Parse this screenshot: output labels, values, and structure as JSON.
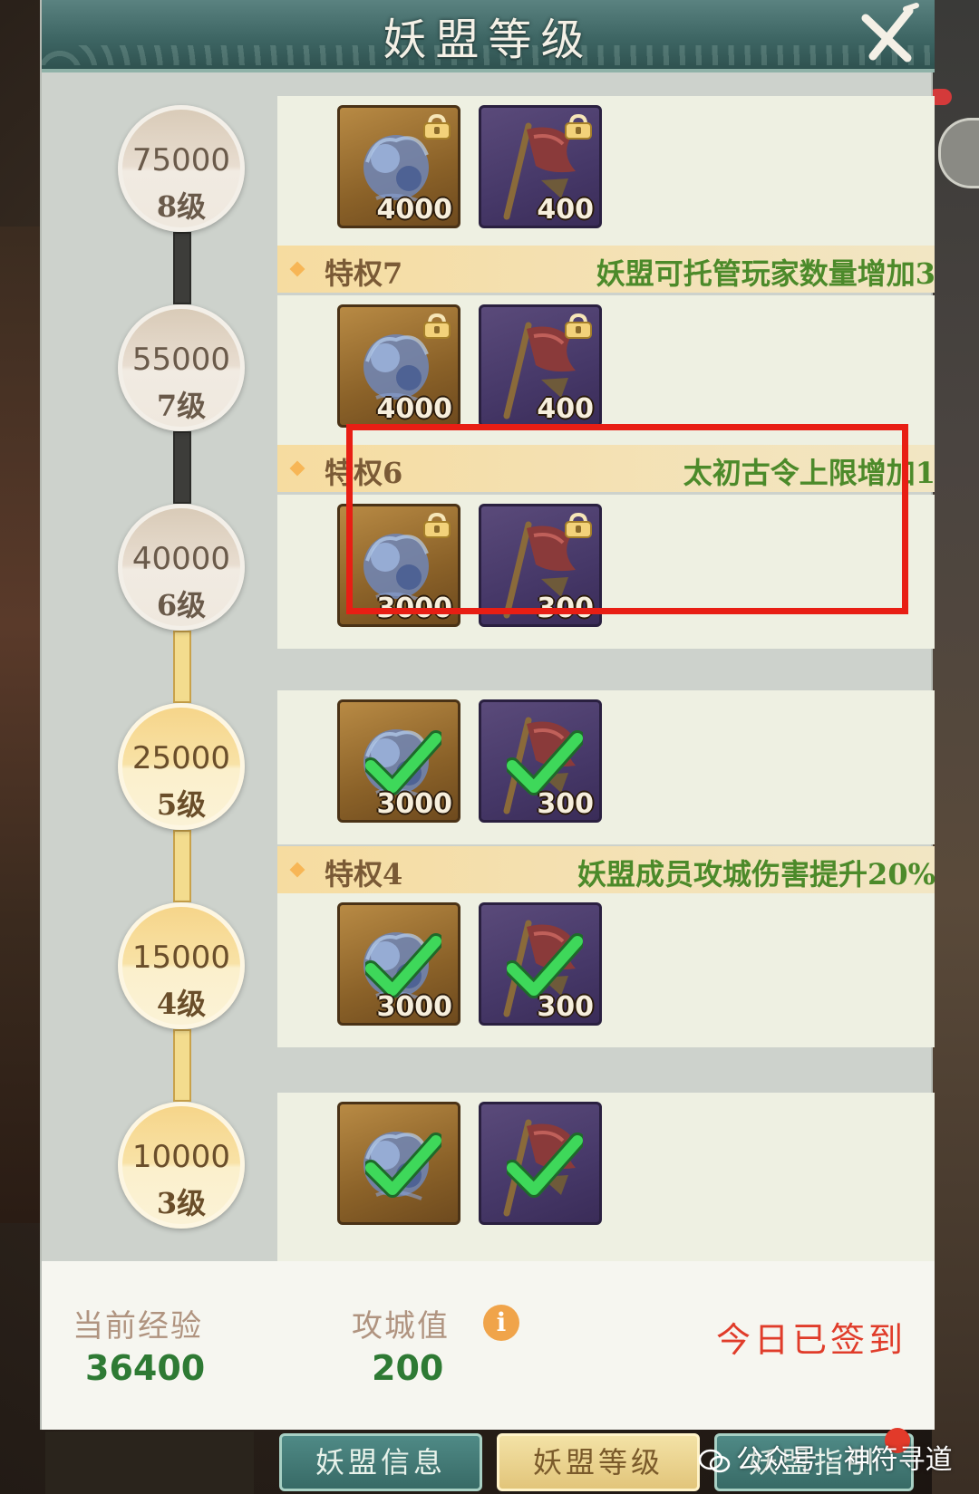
{
  "header": {
    "title": "妖盟等级"
  },
  "levels": [
    {
      "exp": "75000",
      "level": "8级",
      "state": "locked",
      "rewards": [
        {
          "icon": "spirit-orb-icon",
          "qty": "4000",
          "claimed": false,
          "locked": true
        },
        {
          "icon": "war-flag-icon",
          "qty": "400",
          "claimed": false,
          "locked": true
        }
      ]
    },
    {
      "exp": "55000",
      "level": "7级",
      "state": "locked",
      "privilege": {
        "name": "特权7",
        "desc": "妖盟可托管玩家数量增加3"
      },
      "rewards": [
        {
          "icon": "spirit-orb-icon",
          "qty": "4000",
          "claimed": false,
          "locked": true
        },
        {
          "icon": "war-flag-icon",
          "qty": "400",
          "claimed": false,
          "locked": true
        }
      ]
    },
    {
      "exp": "40000",
      "level": "6级",
      "state": "locked",
      "privilege": {
        "name": "特权6",
        "desc": "太初古令上限增加1"
      },
      "rewards": [
        {
          "icon": "spirit-orb-icon",
          "qty": "3000",
          "claimed": false,
          "locked": true
        },
        {
          "icon": "war-flag-icon",
          "qty": "300",
          "claimed": false,
          "locked": true
        }
      ]
    },
    {
      "exp": "25000",
      "level": "5级",
      "state": "unlocked",
      "rewards": [
        {
          "icon": "spirit-orb-icon",
          "qty": "3000",
          "claimed": true,
          "locked": false
        },
        {
          "icon": "war-flag-icon",
          "qty": "300",
          "claimed": true,
          "locked": false
        }
      ]
    },
    {
      "exp": "15000",
      "level": "4级",
      "state": "unlocked",
      "privilege": {
        "name": "特权4",
        "desc": "妖盟成员攻城伤害提升20%"
      },
      "rewards": [
        {
          "icon": "spirit-orb-icon",
          "qty": "3000",
          "claimed": true,
          "locked": false
        },
        {
          "icon": "war-flag-icon",
          "qty": "300",
          "claimed": true,
          "locked": false
        }
      ]
    },
    {
      "exp": "10000",
      "level": "3级",
      "state": "unlocked",
      "rewards": [
        {
          "icon": "spirit-orb-icon",
          "qty": "",
          "claimed": true,
          "locked": false
        },
        {
          "icon": "war-flag-icon",
          "qty": "",
          "claimed": true,
          "locked": false
        }
      ]
    }
  ],
  "footer": {
    "exp_label": "当前经验",
    "exp_value": "36400",
    "siege_label": "攻城值",
    "siege_value": "200",
    "info_glyph": "i",
    "signed_text": "今日已签到"
  },
  "tabs": [
    {
      "label": "妖盟信息"
    },
    {
      "label": "妖盟等级"
    },
    {
      "label": "妖盟指引"
    }
  ],
  "watermark": {
    "text": "公众号 · 神符寻道"
  },
  "colors": {
    "accent_green": "#2e7a34",
    "highlight_red": "#e81e14",
    "signed_red": "#e03c2a",
    "privilege_green": "#4c8a2a"
  }
}
